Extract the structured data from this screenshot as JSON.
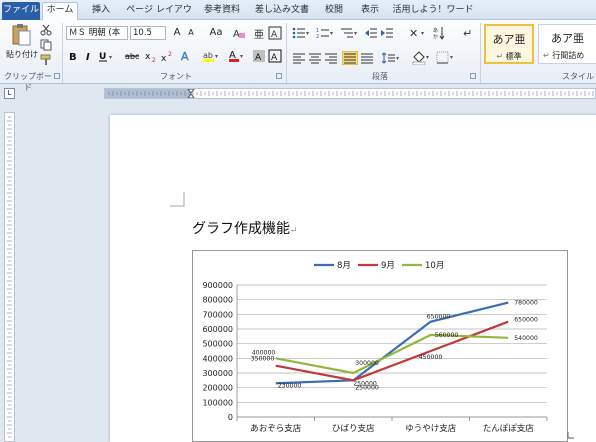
{
  "tabs": [
    "ファイル",
    "ホーム",
    "挿入",
    "ページ レイアウト",
    "参考資料",
    "差し込み文書",
    "校閲",
    "表示",
    "活用しよう！ワード"
  ],
  "ribbon": {
    "clipboard": {
      "paste_label": "貼り付け",
      "group_label": "クリップボード"
    },
    "font": {
      "name": "ＭＳ 明朝 (本",
      "size": "10.5",
      "group_label": "フォント",
      "aa_label": "Aa",
      "btn_a_grow": "A",
      "btn_a_shrink": "A"
    },
    "paragraph": {
      "group_label": "段落"
    },
    "styles": {
      "group_label": "スタイル",
      "items": [
        {
          "sample": "あア亜",
          "name": "標準"
        },
        {
          "sample": "あア亜",
          "name": "行間詰め"
        }
      ]
    }
  },
  "document": {
    "heading": "グラフ作成機能",
    "para_mark": "↵"
  },
  "chart_data": {
    "type": "line",
    "categories": [
      "あおぞら支店",
      "ひばり支店",
      "ゆうやけ支店",
      "たんぽぽ支店"
    ],
    "series": [
      {
        "name": "8月",
        "color": "#3b6db3",
        "values": [
          230000,
          250000,
          650000,
          780000
        ]
      },
      {
        "name": "9月",
        "color": "#c0393b",
        "values": [
          350000,
          250000,
          450000,
          650000
        ]
      },
      {
        "name": "10月",
        "color": "#94b640",
        "values": [
          400000,
          300000,
          560000,
          540000
        ]
      }
    ],
    "ylim": [
      0,
      900000
    ],
    "yticks": [
      "0",
      "100000",
      "200000",
      "300000",
      "400000",
      "500000",
      "600000",
      "700000",
      "800000",
      "900000"
    ],
    "legend": "top"
  }
}
